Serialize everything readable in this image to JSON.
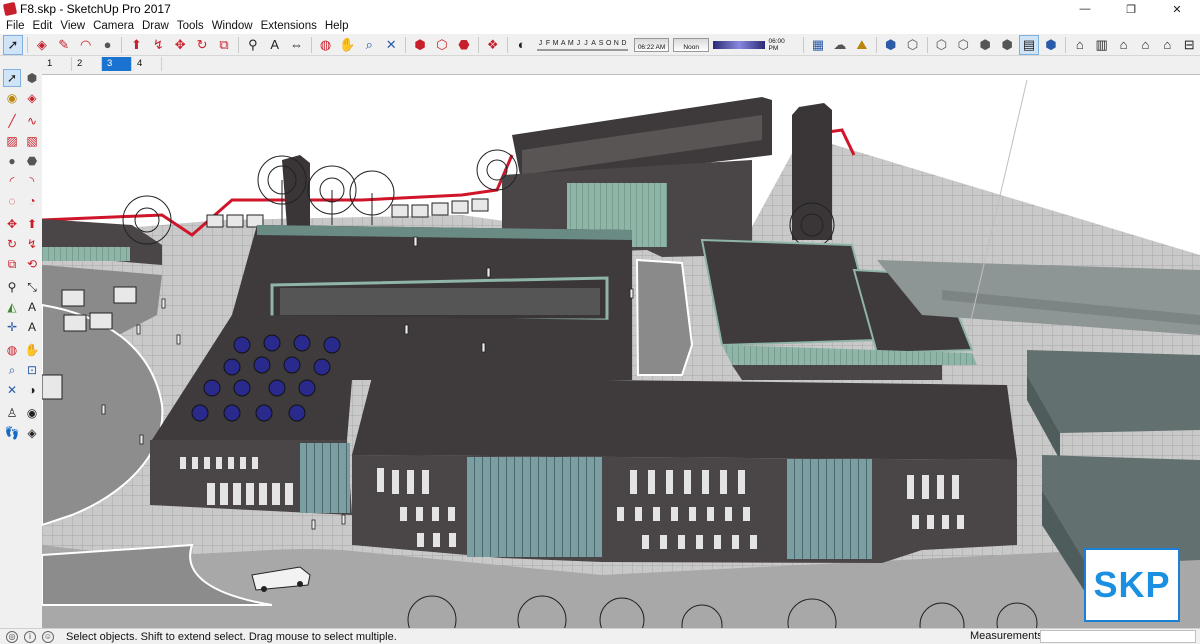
{
  "window": {
    "title": "F8.skp - SketchUp Pro 2017",
    "controls": {
      "minimize": "—",
      "maximize": "❐",
      "close": "✕"
    }
  },
  "menu": [
    "File",
    "Edit",
    "View",
    "Camera",
    "Draw",
    "Tools",
    "Window",
    "Extensions",
    "Help"
  ],
  "toolbar": {
    "icons": [
      "select-arrow",
      "eraser",
      "pencil-line",
      "arc",
      "circle-shape",
      "push-pull",
      "follow-me",
      "move",
      "rotate",
      "scale",
      "tape-measure",
      "text-label",
      "dimension",
      "orbit",
      "pan",
      "zoom",
      "zoom-extents",
      "3d-warehouse",
      "extension-warehouse",
      "layout",
      "shadows"
    ],
    "shadow_months": [
      "J",
      "F",
      "M",
      "A",
      "M",
      "J",
      "J",
      "A",
      "S",
      "O",
      "N",
      "D"
    ],
    "shadow_time_start": "06:22 AM",
    "shadow_time_noon": "Noon",
    "shadow_time_end": "06:00 PM",
    "view_icons": [
      "x-ray",
      "back-edges",
      "wireframe",
      "hidden-line",
      "shaded",
      "shaded-textures",
      "monochrome",
      "iso",
      "top",
      "front",
      "right",
      "back",
      "left"
    ]
  },
  "scenes": [
    "1",
    "2",
    "3",
    "4"
  ],
  "active_scene": "3",
  "status": {
    "message": "Select objects. Shift to extend select. Drag mouse to select multiple.",
    "measurements_label": "Measurements",
    "measurements_value": ""
  },
  "logo": {
    "text": "SKP"
  },
  "colors": {
    "accent": "#1a73d0",
    "roof": "#3f3b3c",
    "wall": "#4a4546",
    "glass": "#8fb5a7",
    "paving": "#c9c9c9",
    "road": "#8a8a8a",
    "outline_red": "#d0142a",
    "umbrella": "#2a2a8c"
  }
}
